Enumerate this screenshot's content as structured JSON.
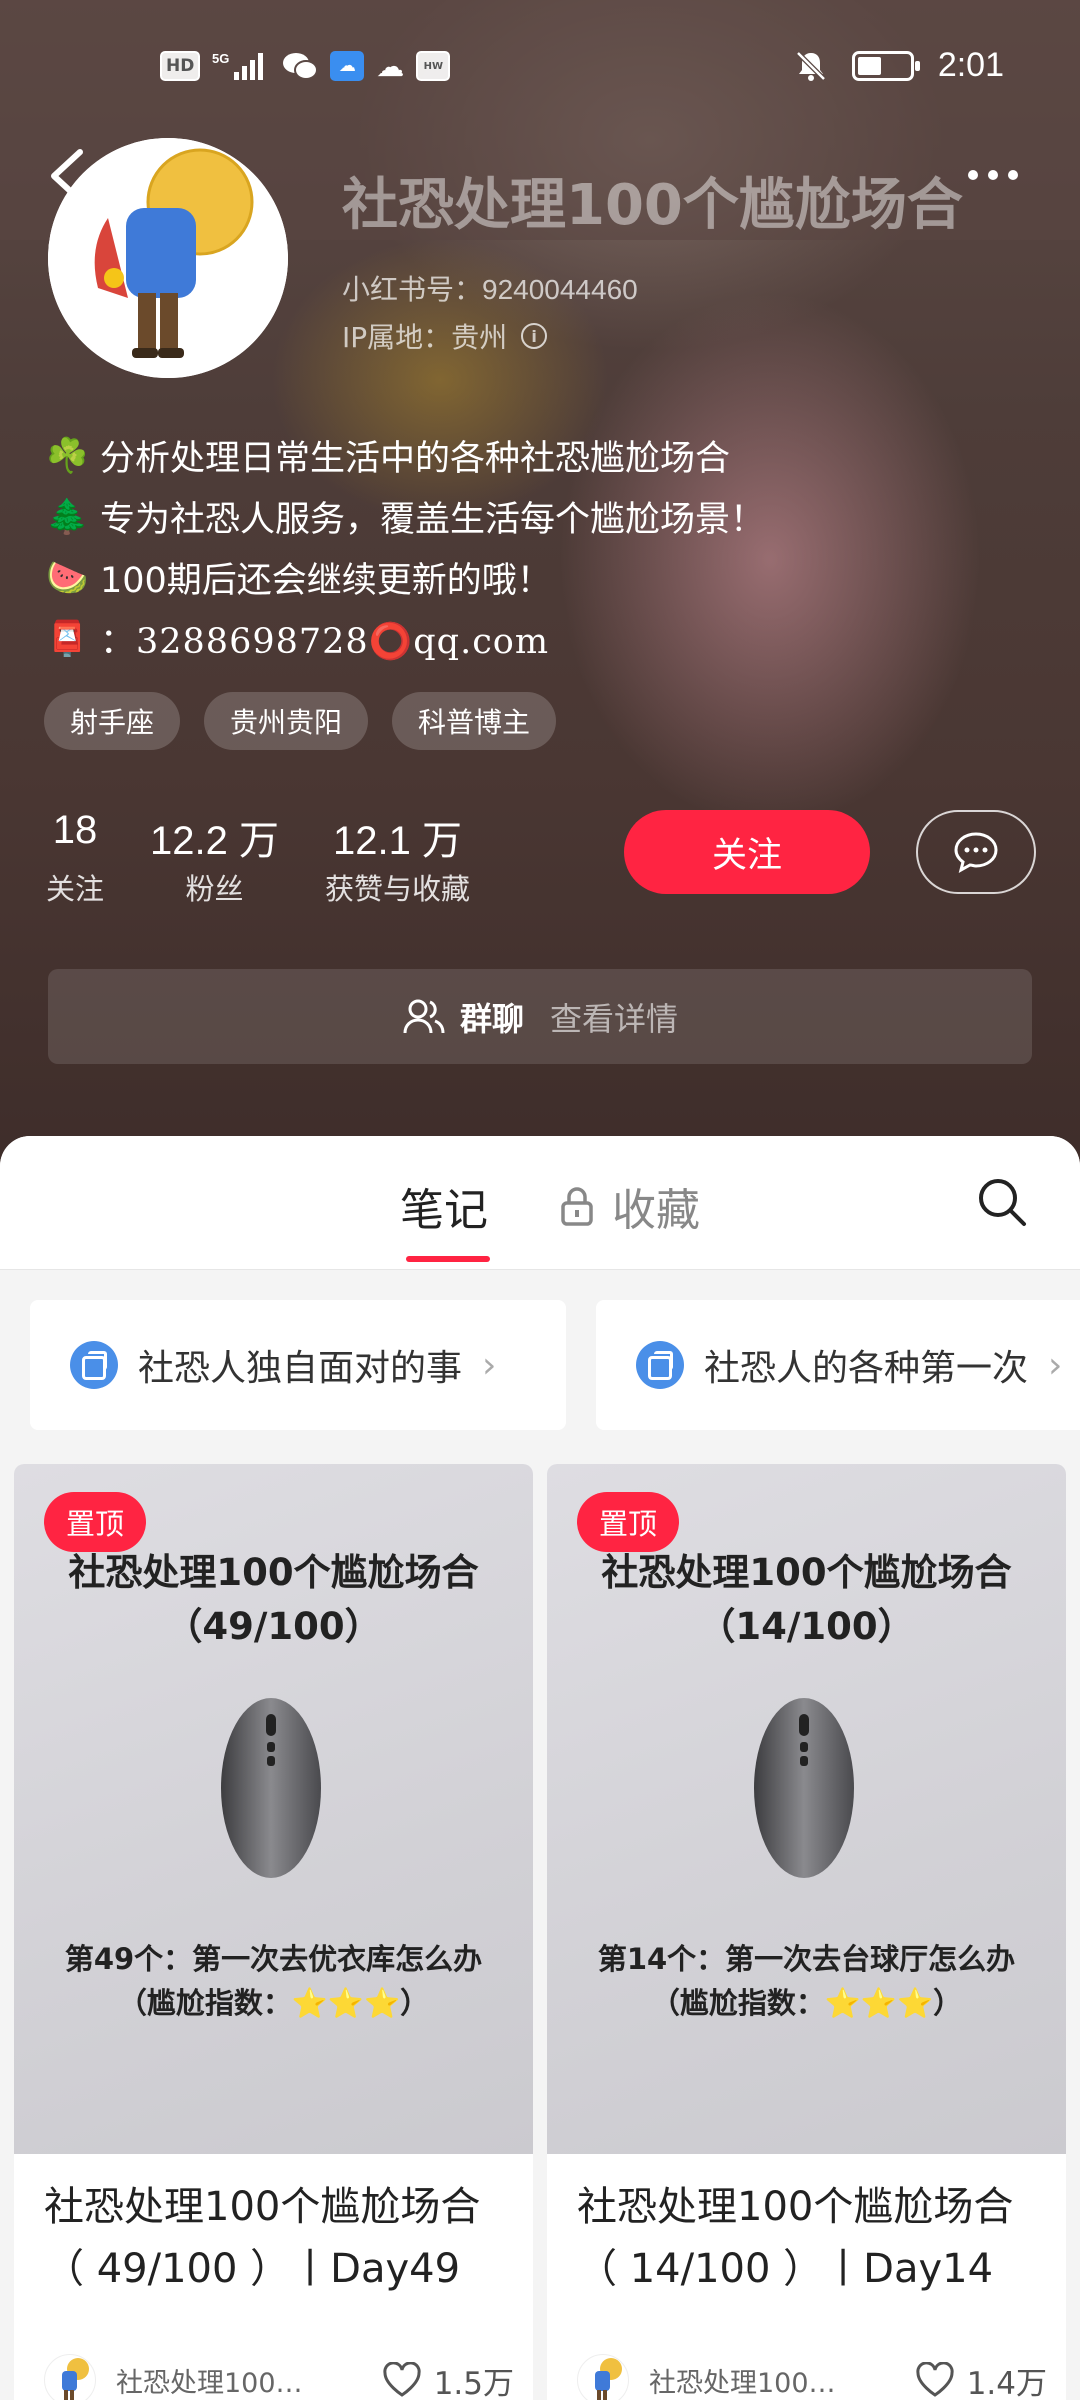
{
  "status_bar": {
    "left_icons": [
      "HD",
      "5G",
      "signal-icon",
      "wechat-icon",
      "cloud-app-icon",
      "cloud-icon",
      "huawei-icon"
    ],
    "time": "2:01",
    "battery_level": 0.45,
    "mute_icon": "bell-off-icon"
  },
  "header": {
    "title": "社恐处理100个尴尬场合",
    "red_id": "小红书号：9240044460",
    "ip": "IP属地：贵州"
  },
  "bio": {
    "lines": [
      {
        "emoji": "☘️",
        "text": "分析处理日常生活中的各种社恐尴尬场合"
      },
      {
        "emoji": "🌲",
        "text": "专为社恐人服务，覆盖生活每个尴尬场景！"
      },
      {
        "emoji": "🍉",
        "text": "100期后还会继续更新的哦！"
      }
    ],
    "mail_emoji": "📮",
    "mail_text": "：3288698728⭕qq.com"
  },
  "tags": [
    "射手座",
    "贵州贵阳",
    "科普博主"
  ],
  "stats": [
    {
      "num": "18",
      "label": "关注"
    },
    {
      "num": "12.2 万",
      "label": "粉丝"
    },
    {
      "num": "12.1 万",
      "label": "获赞与收藏"
    }
  ],
  "follow_label": "关注",
  "group": {
    "title": "群聊",
    "sub": "查看详情"
  },
  "tabs": {
    "notes": "笔记",
    "favorites": "收藏"
  },
  "collections": [
    {
      "label": "社恐人独自面对的事"
    },
    {
      "label": "社恐人的各种第一次"
    }
  ],
  "notes": [
    {
      "pin": "置顶",
      "cover_line1": "社恐处理100个尴尬场合",
      "cover_line2": "（49/100）",
      "cover_line3": "第49个：第一次去优衣库怎么办",
      "cover_line4_prefix": "（尴尬指数：",
      "cover_stars": "⭐⭐⭐",
      "cover_line4_suffix": "）",
      "title": "社恐处理100个尴尬场合（ 49/100 ）丨Day49",
      "author": "社恐处理100…",
      "likes": "1.5万"
    },
    {
      "pin": "置顶",
      "cover_line1": "社恐处理100个尴尬场合",
      "cover_line2": "（14/100）",
      "cover_line3": "第14个：第一次去台球厅怎么办",
      "cover_line4_prefix": "（尴尬指数：",
      "cover_stars": "⭐⭐⭐",
      "cover_line4_suffix": "）",
      "title": "社恐处理100个尴尬场合（ 14/100 ）丨Day14",
      "author": "社恐处理100…",
      "likes": "1.4万"
    }
  ],
  "colors": {
    "accent": "#ff2442",
    "collection_icon": "#4a8fe8"
  }
}
